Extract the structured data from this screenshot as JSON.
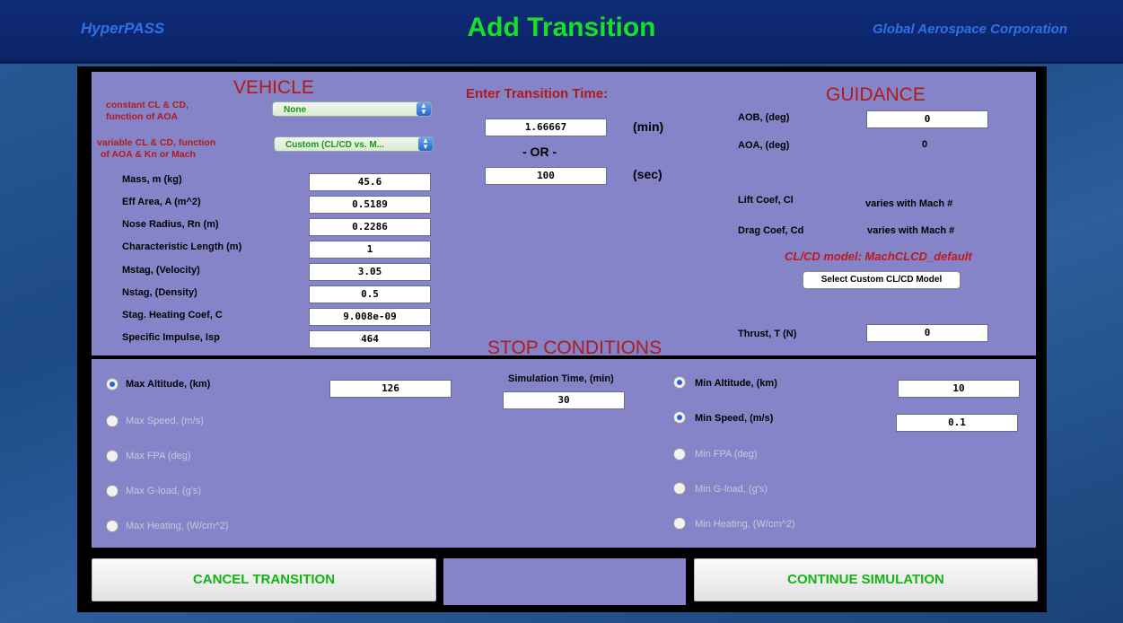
{
  "header": {
    "app_name": "HyperPASS",
    "title": "Add Transition",
    "company": "Global Aerospace Corporation"
  },
  "vehicle": {
    "title": "VEHICLE",
    "const_cl_cd_label_1": "constant CL & CD,",
    "const_cl_cd_label_2": "function of AOA",
    "const_cl_cd_value": "None",
    "var_cl_cd_label_1": "variable CL & CD, function",
    "var_cl_cd_label_2": "of AOA & Kn or Mach",
    "var_cl_cd_value": "Custom (CL/CD vs. M...",
    "fields": [
      {
        "label": "Mass, m      (kg)",
        "value": "45.6"
      },
      {
        "label": "Eff Area, A (m^2)",
        "value": "0.5189"
      },
      {
        "label": "Nose Radius, Rn (m)",
        "value": "0.2286"
      },
      {
        "label": "Characteristic Length (m)",
        "value": "1"
      },
      {
        "label": "Mstag, (Velocity)",
        "value": "3.05"
      },
      {
        "label": "Nstag, (Density)",
        "value": "0.5"
      },
      {
        "label": "Stag. Heating Coef, C",
        "value": "9.008e-09"
      },
      {
        "label": "Specific Impulse, Isp",
        "value": "464"
      }
    ]
  },
  "transition": {
    "title": "Enter Transition Time:",
    "min_value": "1.66667",
    "min_unit": "(min)",
    "or_text": "- OR -",
    "sec_value": "100",
    "sec_unit": "(sec)"
  },
  "guidance": {
    "title": "GUIDANCE",
    "aob_label": "AOB, (deg)",
    "aob_value": "0",
    "aoa_label": "AOA, (deg)",
    "aoa_value": "0",
    "lift_label": "Lift Coef, Cl",
    "lift_value": "varies with Mach #",
    "drag_label": "Drag Coef, Cd",
    "drag_value": "varies with Mach #",
    "model_text": "CL/CD model: MachCLCD_default",
    "select_model_button": "Select Custom CL/CD Model",
    "thrust_label": "Thrust, T      (N)",
    "thrust_value": "0"
  },
  "stop_conditions": {
    "title": "STOP CONDITIONS",
    "sim_time_label": "Simulation Time, (min)",
    "sim_time_value": "30",
    "max": [
      {
        "label": "Max Altitude,   (km)",
        "enabled": true,
        "value": "126"
      },
      {
        "label": "Max Speed, (m/s)",
        "enabled": false
      },
      {
        "label": "Max FPA      (deg)",
        "enabled": false
      },
      {
        "label": "Max G-load, (g's)",
        "enabled": false
      },
      {
        "label": "Max Heating, (W/cm^2)",
        "enabled": false
      }
    ],
    "min": [
      {
        "label": "Min Altitude, (km)",
        "enabled": true,
        "value": "10"
      },
      {
        "label": "Min Speed, (m/s)",
        "enabled": true,
        "value": "0.1"
      },
      {
        "label": "Min FPA      (deg)",
        "enabled": false
      },
      {
        "label": "Min G-load, (g's)",
        "enabled": false
      },
      {
        "label": "Min Heating, (W/cm^2)",
        "enabled": false
      }
    ]
  },
  "buttons": {
    "cancel": "CANCEL TRANSITION",
    "continue": "CONTINUE SIMULATION"
  }
}
